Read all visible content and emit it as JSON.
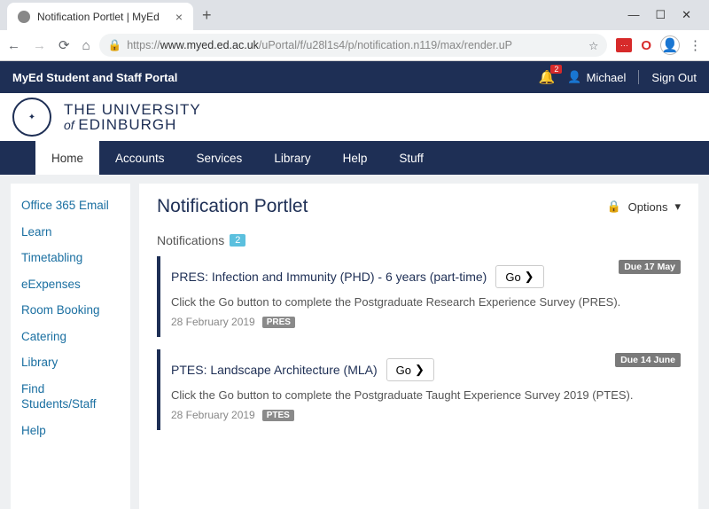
{
  "browser": {
    "tab_title": "Notification Portlet | MyEd",
    "url_prefix": "https://",
    "url_host": "www.myed.ed.ac.uk",
    "url_path": "/uPortal/f/u28l1s4/p/notification.n119/max/render.uP"
  },
  "portal_bar": {
    "title": "MyEd Student and Staff Portal",
    "notif_count": "2",
    "username": "Michael",
    "signout": "Sign Out"
  },
  "university": {
    "line1": "THE UNIVERSITY",
    "line2_of": "of",
    "line2_name": "EDINBURGH"
  },
  "nav": {
    "items": [
      "Home",
      "Accounts",
      "Services",
      "Library",
      "Help",
      "Stuff"
    ],
    "active_index": 0
  },
  "sidebar": {
    "items": [
      "Office 365 Email",
      "Learn",
      "Timetabling",
      "eExpenses",
      "Room Booking",
      "Catering",
      "Library",
      "Find Students/Staff",
      "Help"
    ]
  },
  "content": {
    "title": "Notification Portlet",
    "options_label": "Options",
    "section_label": "Notifications",
    "section_count": "2",
    "notifications": [
      {
        "title": "PRES: Infection and Immunity (PHD) - 6 years (part-time)",
        "go": "Go",
        "due": "Due 17 May",
        "desc": "Click the Go button to complete the Postgraduate Research Experience Survey (PRES).",
        "date": "28 February 2019",
        "tag": "PRES"
      },
      {
        "title": "PTES: Landscape Architecture (MLA)",
        "go": "Go",
        "due": "Due 14 June",
        "desc": "Click the Go button to complete the Postgraduate Taught Experience Survey 2019 (PTES).",
        "date": "28 February 2019",
        "tag": "PTES"
      }
    ]
  }
}
